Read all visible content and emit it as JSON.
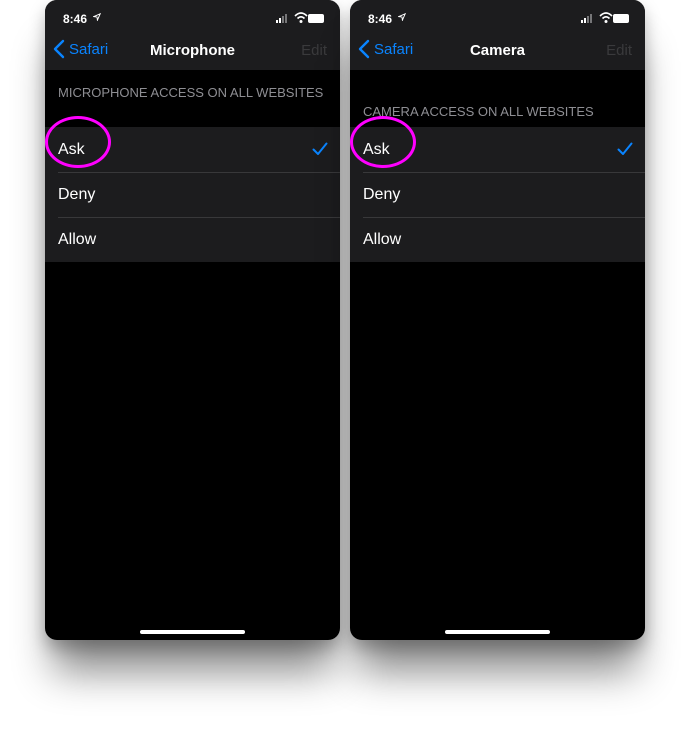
{
  "colors": {
    "accent": "#0a84ff",
    "annotation": "#ff00ff",
    "background": "#000000",
    "cell": "#1c1c1e",
    "secondary_text": "#8e8e93"
  },
  "screens": [
    {
      "status_time": "8:46",
      "back_label": "Safari",
      "title": "Microphone",
      "edit_label": "Edit",
      "section_header": "MICROPHONE ACCESS ON ALL WEBSITES",
      "options": [
        "Ask",
        "Deny",
        "Allow"
      ],
      "selected_option": "Ask",
      "icons": [
        "location-arrow-icon",
        "signal-icon",
        "wifi-icon",
        "battery-icon",
        "chevron-left-icon",
        "checkmark-icon"
      ]
    },
    {
      "status_time": "8:46",
      "back_label": "Safari",
      "title": "Camera",
      "edit_label": "Edit",
      "section_header": "CAMERA ACCESS ON ALL WEBSITES",
      "options": [
        "Ask",
        "Deny",
        "Allow"
      ],
      "selected_option": "Ask",
      "icons": [
        "location-arrow-icon",
        "signal-icon",
        "wifi-icon",
        "battery-icon",
        "chevron-left-icon",
        "checkmark-icon"
      ]
    }
  ]
}
